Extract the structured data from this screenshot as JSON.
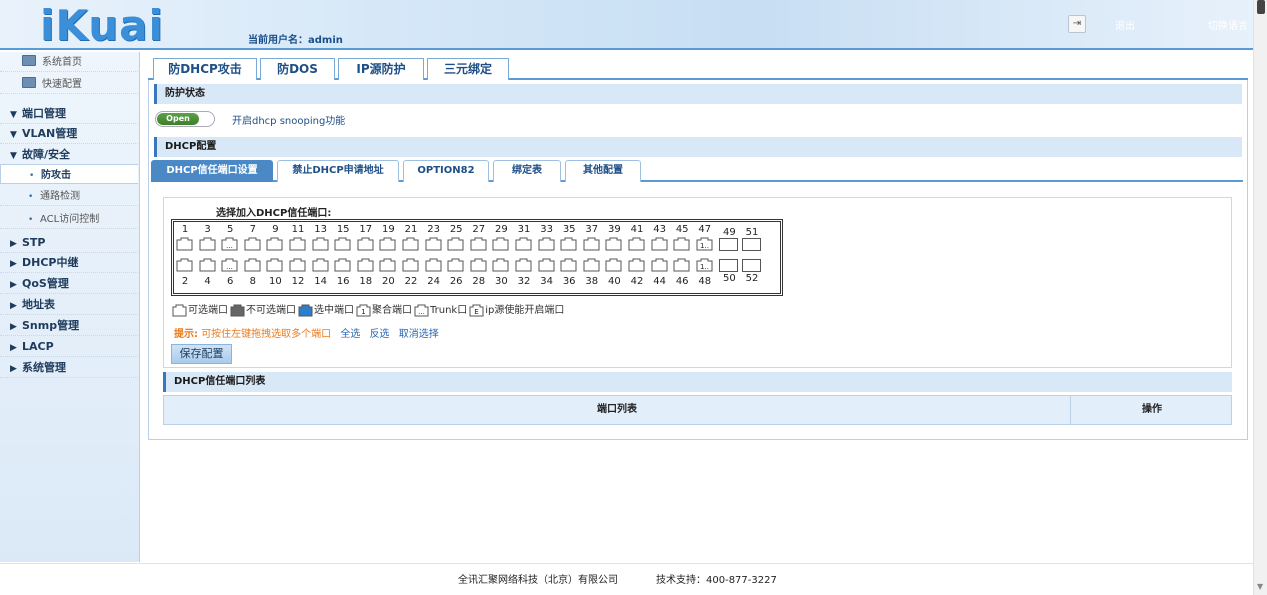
{
  "header": {
    "logo": "iKuai",
    "user_label": "当前用户名：",
    "user_name": "admin",
    "logout": "退出",
    "lang": "切换语言"
  },
  "sidebar": {
    "items": [
      {
        "label": "系统首页",
        "kind": "sub",
        "icon": "monitor-icon"
      },
      {
        "label": "快速配置",
        "kind": "sub",
        "icon": "wizard-icon"
      },
      {
        "label": "端口管理",
        "kind": "grp",
        "open": true
      },
      {
        "label": "VLAN管理",
        "kind": "grp",
        "open": true
      },
      {
        "label": "故障/安全",
        "kind": "grp",
        "open": true
      },
      {
        "label": "防攻击",
        "kind": "leaf",
        "active": true
      },
      {
        "label": "通路检测",
        "kind": "leaf"
      },
      {
        "label": "ACL访问控制",
        "kind": "leaf"
      },
      {
        "label": "STP",
        "kind": "grp"
      },
      {
        "label": "DHCP中继",
        "kind": "grp"
      },
      {
        "label": "QoS管理",
        "kind": "grp"
      },
      {
        "label": "地址表",
        "kind": "grp"
      },
      {
        "label": "Snmp管理",
        "kind": "grp"
      },
      {
        "label": "LACP",
        "kind": "grp"
      },
      {
        "label": "系统管理",
        "kind": "grp"
      }
    ]
  },
  "top_tabs": [
    "防DHCP攻击",
    "防DOS",
    "IP源防护",
    "三元绑定"
  ],
  "protect_state": {
    "title": "防护状态",
    "toggle_label": "Open",
    "snooping_label": "开启dhcp snooping功能"
  },
  "dhcp_config": {
    "title": "DHCP配置",
    "sub_tabs": [
      "DHCP信任端口设置",
      "禁止DHCP申请地址",
      "OPTION82",
      "绑定表",
      "其他配置"
    ],
    "select_title": "选择加入DHCP信任端口:",
    "top_numbers": [
      "1",
      "3",
      "5",
      "7",
      "9",
      "11",
      "13",
      "15",
      "17",
      "19",
      "21",
      "23",
      "25",
      "27",
      "29",
      "31",
      "33",
      "35",
      "37",
      "39",
      "41",
      "43",
      "45",
      "47",
      "49",
      "51"
    ],
    "bottom_numbers": [
      "2",
      "4",
      "6",
      "8",
      "10",
      "12",
      "14",
      "16",
      "18",
      "20",
      "22",
      "24",
      "26",
      "28",
      "30",
      "32",
      "34",
      "36",
      "38",
      "40",
      "42",
      "44",
      "46",
      "48",
      "50",
      "52"
    ],
    "legend": [
      "可选端口",
      "不可选端口",
      "选中端口",
      "聚合端口",
      "Trunk口",
      "ip源使能开启端口"
    ],
    "legend_icon_text": {
      "agg": "1",
      "trunk": "...",
      "ipsrc": "E"
    },
    "port_marks": {
      "trunk": "...",
      "agg": "1.."
    },
    "tip_prefix": "提示:",
    "tip_text": "可按住左键拖拽选取多个端口",
    "tip_links": [
      "全选",
      "反选",
      "取消选择"
    ],
    "save_button": "保存配置"
  },
  "port_list": {
    "title": "DHCP信任端口列表",
    "columns": [
      "端口列表",
      "操作"
    ]
  },
  "footer": {
    "company": "全讯汇聚网络科技（北京）有限公司",
    "support": "技术支持：400-877-3227"
  },
  "colors": {
    "accent": "#5b9bd5",
    "tab_active": "#4b88c6",
    "tip": "#e87b1e",
    "toggle_on": "#4e9238"
  }
}
